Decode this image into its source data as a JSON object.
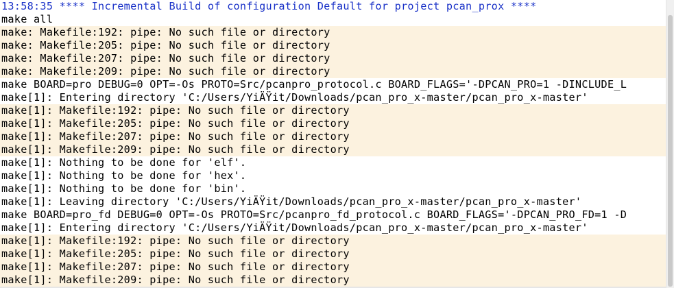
{
  "console": {
    "lines": [
      {
        "text": "13:58:35 **** Incremental Build of configuration Default for project pcan_prox ****",
        "kind": "header"
      },
      {
        "text": "make all",
        "kind": "normal"
      },
      {
        "text": "make: Makefile:192: pipe: No such file or directory",
        "kind": "warn"
      },
      {
        "text": "make: Makefile:205: pipe: No such file or directory",
        "kind": "warn"
      },
      {
        "text": "make: Makefile:207: pipe: No such file or directory",
        "kind": "warn"
      },
      {
        "text": "make: Makefile:209: pipe: No such file or directory",
        "kind": "warn"
      },
      {
        "text": "make BOARD=pro DEBUG=0 OPT=-Os PROTO=Src/pcanpro_protocol.c BOARD_FLAGS='-DPCAN_PRO=1 -DINCLUDE_L",
        "kind": "normal"
      },
      {
        "text": "make[1]: Entering directory 'C:/Users/YiÄŸit/Downloads/pcan_pro_x-master/pcan_pro_x-master'",
        "kind": "normal"
      },
      {
        "text": "make[1]: Makefile:192: pipe: No such file or directory",
        "kind": "warn"
      },
      {
        "text": "make[1]: Makefile:205: pipe: No such file or directory",
        "kind": "warn"
      },
      {
        "text": "make[1]: Makefile:207: pipe: No such file or directory",
        "kind": "warn"
      },
      {
        "text": "make[1]: Makefile:209: pipe: No such file or directory",
        "kind": "warn"
      },
      {
        "text": "make[1]: Nothing to be done for 'elf'.",
        "kind": "normal"
      },
      {
        "text": "make[1]: Nothing to be done for 'hex'.",
        "kind": "normal"
      },
      {
        "text": "make[1]: Nothing to be done for 'bin'.",
        "kind": "normal"
      },
      {
        "text": "make[1]: Leaving directory 'C:/Users/YiÄŸit/Downloads/pcan_pro_x-master/pcan_pro_x-master'",
        "kind": "normal"
      },
      {
        "text": "make BOARD=pro_fd DEBUG=0 OPT=-Os PROTO=Src/pcanpro_fd_protocol.c BOARD_FLAGS='-DPCAN_PRO_FD=1 -D",
        "kind": "normal"
      },
      {
        "text": "make[1]: Entering directory 'C:/Users/YiÄŸit/Downloads/pcan_pro_x-master/pcan_pro_x-master'",
        "kind": "normal"
      },
      {
        "text": "make[1]: Makefile:192: pipe: No such file or directory",
        "kind": "warn"
      },
      {
        "text": "make[1]: Makefile:205: pipe: No such file or directory",
        "kind": "warn"
      },
      {
        "text": "make[1]: Makefile:207: pipe: No such file or directory",
        "kind": "warn"
      },
      {
        "text": "make[1]: Makefile:209: pipe: No such file or directory",
        "kind": "warn"
      }
    ]
  },
  "colors": {
    "header_text": "#1a32c8",
    "warn_background": "#fcf2df",
    "text": "#000000"
  }
}
